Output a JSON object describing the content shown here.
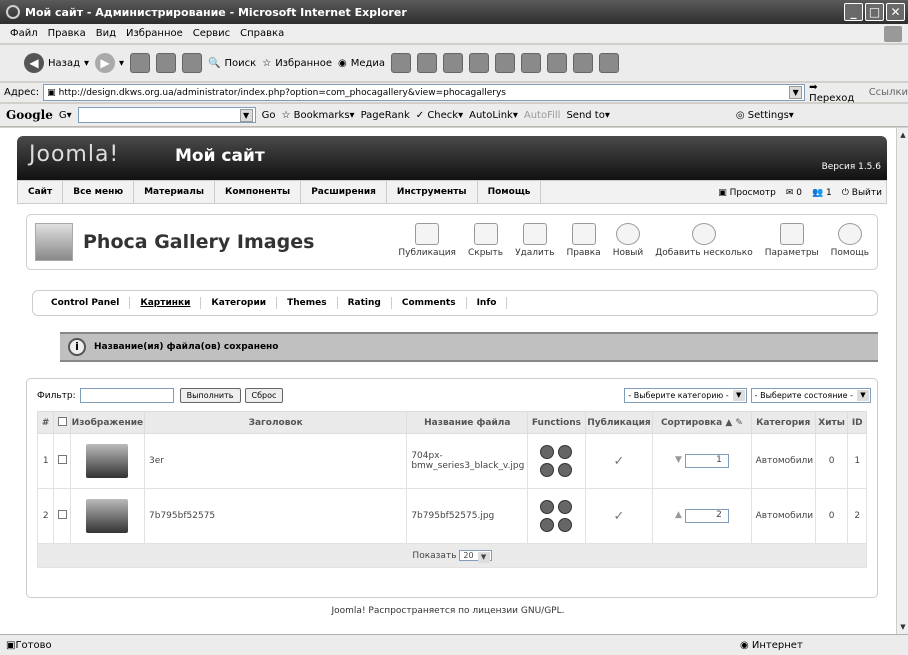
{
  "window": {
    "title": "Мой сайт - Администрирование - Microsoft Internet Explorer"
  },
  "menu": [
    "Файл",
    "Правка",
    "Вид",
    "Избранное",
    "Сервис",
    "Справка"
  ],
  "toolbar": {
    "back": "Назад",
    "search": "Поиск",
    "favorites": "Избранное",
    "media": "Медиа"
  },
  "address": {
    "label": "Адрес:",
    "url": "http://design.dkws.org.ua/administrator/index.php?option=com_phocagallery&view=phocagallerys",
    "go": "Переход",
    "links": "Ссылки"
  },
  "google": {
    "logo": "Google",
    "go": "Go",
    "bookmarks": "Bookmarks",
    "pagerank": "PageRank",
    "check": "Check",
    "autolink": "AutoLink",
    "autofill": "AutoFill",
    "sendto": "Send to",
    "settings": "Settings"
  },
  "joomla": {
    "logo": "Joomla!",
    "site": "Мой сайт",
    "version": "Версия 1.5.6"
  },
  "jmenu": [
    "Сайт",
    "Все меню",
    "Материалы",
    "Компоненты",
    "Расширения",
    "Инструменты",
    "Помощь"
  ],
  "jright": {
    "preview": "Просмотр",
    "msgs": "0",
    "users": "1",
    "logout": "Выйти"
  },
  "panel": {
    "title": "Phoca Gallery Images"
  },
  "tools": [
    "Публикация",
    "Скрыть",
    "Удалить",
    "Правка",
    "Новый",
    "Добавить несколько",
    "Параметры",
    "Помощь"
  ],
  "subnav": [
    "Control Panel",
    "Картинки",
    "Категории",
    "Themes",
    "Rating",
    "Comments",
    "Info"
  ],
  "message": "Название(ия) файла(ов) сохранено",
  "filter": {
    "label": "Фильтр:",
    "go": "Выполнить",
    "reset": "Сброс",
    "category": "- Выберите категорию -",
    "state": "- Выберите состояние -"
  },
  "table": {
    "headers": [
      "#",
      "",
      "Изображение",
      "Заголовок",
      "Название файла",
      "Functions",
      "Публикация",
      "Сортировка",
      "Категория",
      "Хиты",
      "ID"
    ],
    "rows": [
      {
        "num": "1",
        "title": "3er",
        "filename": "704px-bmw_series3_black_v.jpg",
        "order": "1",
        "category": "Автомобили",
        "hits": "0",
        "id": "1"
      },
      {
        "num": "2",
        "title": "7b795bf52575",
        "filename": "7b795bf52575.jpg",
        "order": "2",
        "category": "Автомобили",
        "hits": "0",
        "id": "2"
      }
    ],
    "show_label": "Показать",
    "show_value": "20"
  },
  "footer": "Joomla! Распространяется по лицензии GNU/GPL.",
  "status": {
    "ready": "Готово",
    "zone": "Интернет"
  }
}
